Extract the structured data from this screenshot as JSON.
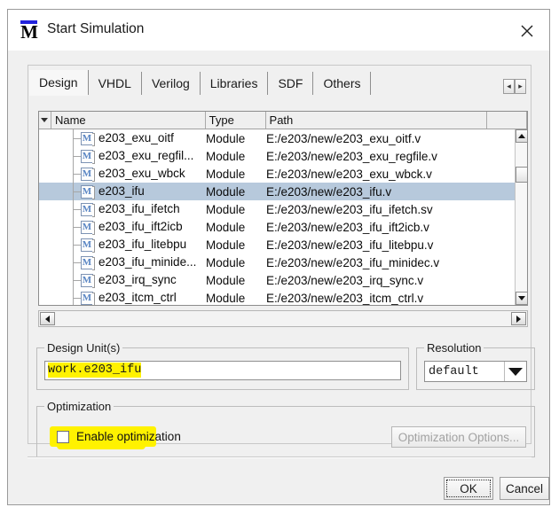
{
  "window": {
    "title": "Start Simulation",
    "icon": "modelsim-m-icon",
    "close_label": "✕"
  },
  "tabs": [
    {
      "label": "Design",
      "active": true
    },
    {
      "label": "VHDL",
      "active": false
    },
    {
      "label": "Verilog",
      "active": false
    },
    {
      "label": "Libraries",
      "active": false
    },
    {
      "label": "SDF",
      "active": false
    },
    {
      "label": "Others",
      "active": false
    }
  ],
  "tab_scroll": {
    "left": "◂",
    "right": "▸"
  },
  "list": {
    "columns": [
      "Name",
      "Type",
      "Path"
    ],
    "rows": [
      {
        "name": "e203_exu_oitf",
        "type": "Module",
        "path": "E:/e203/new/e203_exu_oitf.v",
        "selected": false
      },
      {
        "name": "e203_exu_regfil...",
        "type": "Module",
        "path": "E:/e203/new/e203_exu_regfile.v",
        "selected": false
      },
      {
        "name": "e203_exu_wbck",
        "type": "Module",
        "path": "E:/e203/new/e203_exu_wbck.v",
        "selected": false
      },
      {
        "name": "e203_ifu",
        "type": "Module",
        "path": "E:/e203/new/e203_ifu.v",
        "selected": true
      },
      {
        "name": "e203_ifu_ifetch",
        "type": "Module",
        "path": "E:/e203/new/e203_ifu_ifetch.sv",
        "selected": false
      },
      {
        "name": "e203_ifu_ift2icb",
        "type": "Module",
        "path": "E:/e203/new/e203_ifu_ift2icb.v",
        "selected": false
      },
      {
        "name": "e203_ifu_litebpu",
        "type": "Module",
        "path": "E:/e203/new/e203_ifu_litebpu.v",
        "selected": false
      },
      {
        "name": "e203_ifu_minide...",
        "type": "Module",
        "path": "E:/e203/new/e203_ifu_minidec.v",
        "selected": false
      },
      {
        "name": "e203_irq_sync",
        "type": "Module",
        "path": "E:/e203/new/e203_irq_sync.v",
        "selected": false
      },
      {
        "name": "e203_itcm_ctrl",
        "type": "Module",
        "path": "E:/e203/new/e203_itcm_ctrl.v",
        "selected": false
      }
    ],
    "row_icon": "M",
    "selection_color": "#b7c9dc"
  },
  "design_unit": {
    "legend": "Design Unit(s)",
    "value": "work.e203_ifu",
    "highlight_color": "#fff200"
  },
  "resolution": {
    "legend": "Resolution",
    "value": "default"
  },
  "optimization": {
    "legend": "Optimization",
    "checkbox_label": "Enable optimization",
    "checked": false,
    "options_button": "Optimization Options...",
    "options_button_enabled": false,
    "highlight_color": "#fff200"
  },
  "footer": {
    "ok": "OK",
    "cancel": "Cancel"
  }
}
